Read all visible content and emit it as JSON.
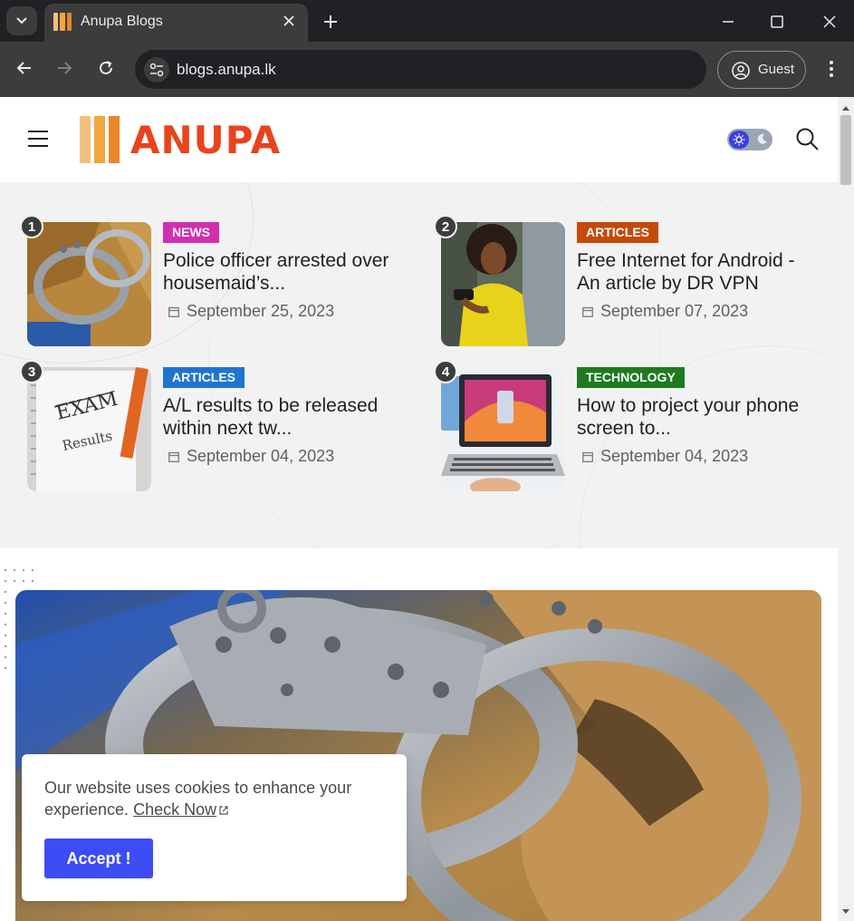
{
  "browser": {
    "tab_title": "Anupa Blogs",
    "url": "blogs.anupa.lk",
    "profile_label": "Guest"
  },
  "site": {
    "logo_text": "ANUPA",
    "colors": {
      "logo_orange": "#e8431c",
      "bar_light": "#f1c07c",
      "bar_mid": "#f2a541",
      "bar_dark": "#e8862b",
      "accent_blue": "#3d4df5"
    }
  },
  "featured": [
    {
      "rank": "1",
      "category": "NEWS",
      "category_color": "#d12fae",
      "title": "Police officer arrested over housemaid’s...",
      "date": "September 25, 2023",
      "thumb": "handcuffs"
    },
    {
      "rank": "2",
      "category": "ARTICLES",
      "category_color": "#c44a08",
      "title": "Free Internet for Android - An article by DR VPN",
      "date": "September 07, 2023",
      "thumb": "woman-phone"
    },
    {
      "rank": "3",
      "category": "ARTICLES",
      "category_color": "#1f74d1",
      "title": "A/L results to be released within next tw...",
      "date": "September 04, 2023",
      "thumb": "exam-notebook"
    },
    {
      "rank": "4",
      "category": "TECHNOLOGY",
      "category_color": "#1f7a1f",
      "title": "How to project your phone screen to...",
      "date": "September 04, 2023",
      "thumb": "laptop"
    }
  ],
  "cookie": {
    "message": "Our website uses cookies to enhance your experience.",
    "link_text": "Check Now",
    "button_label": "Accept !"
  }
}
